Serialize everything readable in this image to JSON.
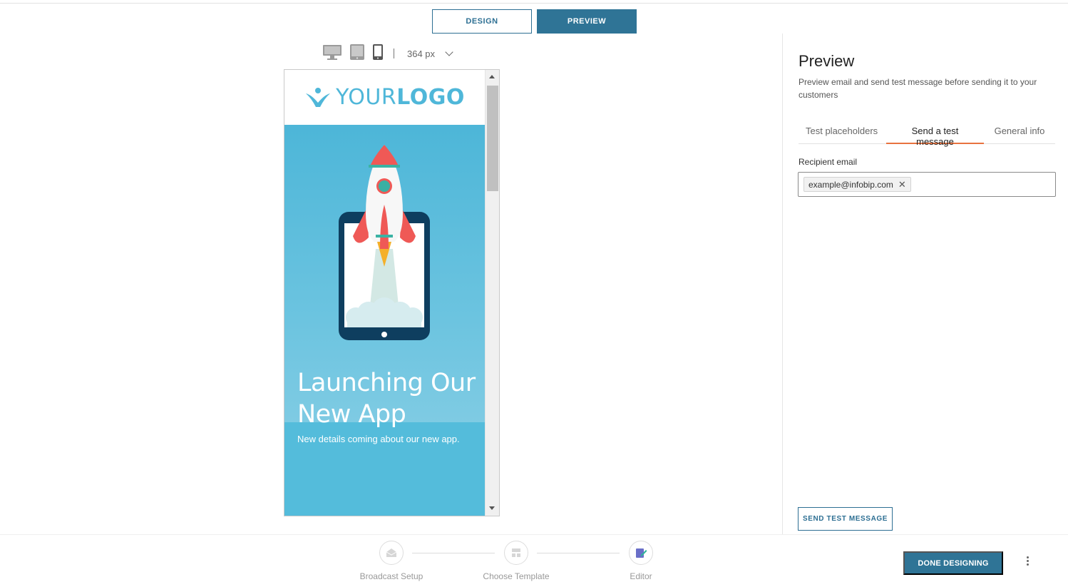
{
  "mode_tabs": {
    "design": "DESIGN",
    "preview": "PREVIEW"
  },
  "device_toolbar": {
    "devices": [
      "desktop-icon",
      "tablet-icon",
      "mobile-icon"
    ],
    "width_value": "364 px"
  },
  "email_preview": {
    "logo_light": "YOUR",
    "logo_bold": "LOGO",
    "hero_title_line1": "Launching Our",
    "hero_title_line2": "New App",
    "hero_subtitle": "New details coming about our new app."
  },
  "panel": {
    "title": "Preview",
    "description": "Preview email and send test message before sending it to your customers",
    "tabs": [
      "Test placeholders",
      "Send a test message",
      "General info"
    ],
    "active_tab": "Send a test message",
    "recipient_label": "Recipient email",
    "recipient_chip": "example@infobip.com",
    "send_button": "SEND TEST MESSAGE"
  },
  "steps": [
    {
      "label": "Broadcast Setup",
      "icon": "envelope-icon"
    },
    {
      "label": "Choose Template",
      "icon": "template-icon"
    },
    {
      "label": "Editor",
      "icon": "edit-icon"
    }
  ],
  "done_button": "DONE DESIGNING",
  "colors": {
    "accent": "#2f7496",
    "tab_underline": "#e8733f",
    "hero": "#54bcdb"
  }
}
